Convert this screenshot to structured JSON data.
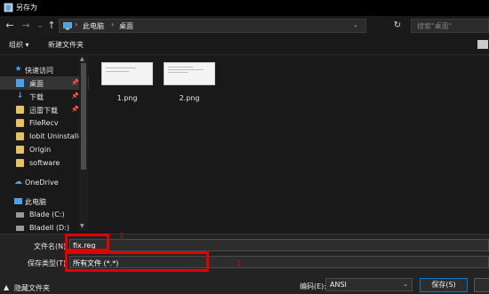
{
  "window": {
    "title": "另存为"
  },
  "nav": {
    "back": "←",
    "forward": "→",
    "recent": "⌄",
    "up": "↑",
    "crumbs": [
      "此电脑",
      "桌面"
    ],
    "search_placeholder": "搜索\"桌面\""
  },
  "toolbar": {
    "organize": "组织 ▾",
    "new_folder": "新建文件夹"
  },
  "sidebar": {
    "items": [
      {
        "label": "快速访问"
      },
      {
        "label": "桌面"
      },
      {
        "label": "下载"
      },
      {
        "label": "迅雷下载"
      },
      {
        "label": "FileRecv"
      },
      {
        "label": "Iobit Uninstaller"
      },
      {
        "label": "Origin"
      },
      {
        "label": "software"
      },
      {
        "label": "OneDrive"
      },
      {
        "label": "此电脑"
      },
      {
        "label": "Blade (C:)"
      },
      {
        "label": "BladeII (D:)"
      }
    ]
  },
  "files": [
    {
      "name": "1.png"
    },
    {
      "name": "2.png"
    }
  ],
  "form": {
    "filename_label": "文件名(N):",
    "filename_value": "fix.reg",
    "type_label": "保存类型(T):",
    "type_value": "所有文件  (*.*)",
    "annotation_filename": "2",
    "annotation_type": "1",
    "hide_folders": "隐藏文件夹",
    "encoding_label": "编码(E):",
    "encoding_value": "ANSI",
    "save_button": "保存(S)"
  },
  "colors": {
    "highlight": "#e50000",
    "accent": "#0078d7"
  }
}
